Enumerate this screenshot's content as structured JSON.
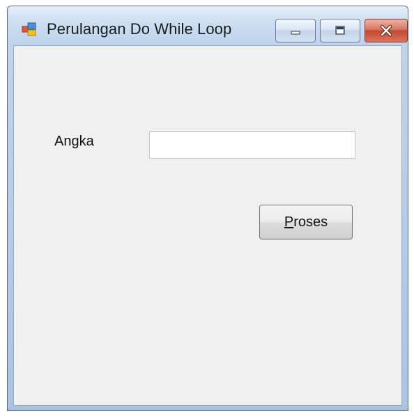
{
  "window": {
    "title": "Perulangan Do While Loop",
    "icon": "winforms-app-icon",
    "controls": {
      "minimize_icon": "minimize-icon",
      "maximize_icon": "maximize-icon",
      "close_icon": "close-icon"
    }
  },
  "form": {
    "angka_label": "Angka",
    "angka_value": "",
    "proses_button": {
      "mnemonic": "P",
      "rest": "roses"
    }
  },
  "colors": {
    "titlebar": "#c7dbf0",
    "client": "#f0f0f0",
    "close_button": "#c94a31"
  }
}
